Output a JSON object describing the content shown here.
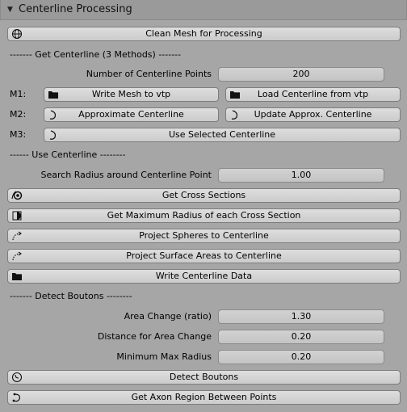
{
  "panel": {
    "title": "Centerline Processing"
  },
  "clean_mesh_button": "Clean Mesh for Processing",
  "get_centerline": {
    "section_label": "------- Get Centerline (3 Methods) -------",
    "num_points_label": "Number of Centerline Points",
    "num_points_value": "200",
    "m1_label": "M1:",
    "write_mesh_button": "Write Mesh to vtp",
    "load_centerline_button": "Load Centerline from vtp",
    "m2_label": "M2:",
    "approximate_button": "Approximate Centerline",
    "update_approx_button": "Update Approx. Centerline",
    "m3_label": "M3:",
    "use_selected_button": "Use Selected Centerline"
  },
  "use_centerline": {
    "section_label": "------ Use Centerline --------",
    "search_radius_label": "Search Radius around Centerline Point",
    "search_radius_value": "1.00",
    "get_cross_sections_button": "Get Cross Sections",
    "get_max_radius_button": "Get Maximum Radius of each Cross Section",
    "project_spheres_button": "Project Spheres to Centerline",
    "project_surface_button": "Project Surface Areas to Centerline",
    "write_data_button": "Write Centerline Data"
  },
  "detect_boutons": {
    "section_label": "------- Detect Boutons --------",
    "area_change_label": "Area Change (ratio)",
    "area_change_value": "1.30",
    "distance_label": "Distance for Area Change",
    "distance_value": "0.20",
    "min_max_radius_label": "Minimum Max Radius",
    "min_max_radius_value": "0.20",
    "detect_button": "Detect Boutons",
    "axon_region_button": "Get Axon Region Between Points"
  }
}
